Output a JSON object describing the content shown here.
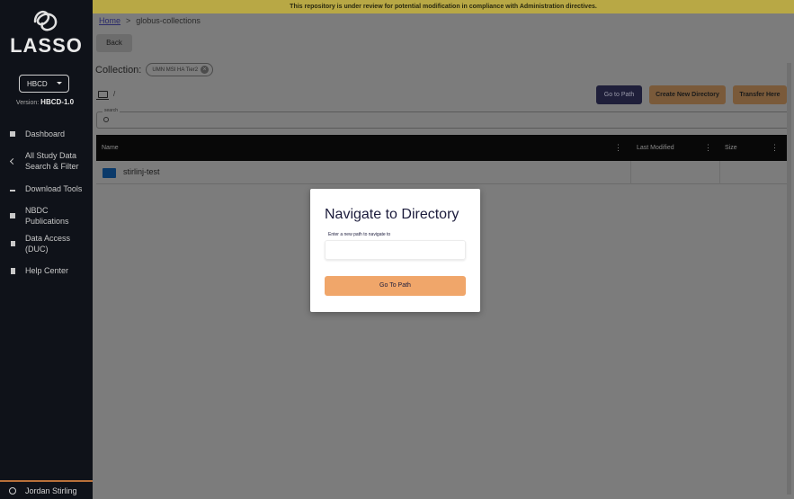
{
  "app": {
    "logo_text": "LASSO"
  },
  "banner": {
    "text": "This repository is under review for potential modification in compliance with Administration directives."
  },
  "sidebar": {
    "study_select": {
      "value": "HBCD"
    },
    "version_label": "Version:",
    "version_value": "HBCD-1.0",
    "items": [
      {
        "label": "Dashboard",
        "icon": "grid-icon"
      },
      {
        "label": "All Study Data Search & Filter",
        "icon": "chart-icon"
      },
      {
        "label": "Download Tools",
        "icon": "download-icon"
      },
      {
        "label": "NBDC Publications",
        "icon": "publication-icon"
      },
      {
        "label": "Data Access (DUC)",
        "icon": "lock-icon"
      },
      {
        "label": "Help Center",
        "icon": "book-icon"
      }
    ],
    "user_name": "Jordan Stirling"
  },
  "breadcrumb": {
    "home": "Home",
    "separator": ">",
    "current": "globus-collections"
  },
  "main": {
    "back_label": "Back",
    "collection_label": "Collection:",
    "collection_chip": "UMN MSI HA Tier2",
    "path": "/",
    "go_to_path_label": "Go to Path",
    "create_dir_label": "Create New Directory",
    "transfer_label": "Transfer Here",
    "search_label": "search",
    "table": {
      "columns": [
        "Name",
        "Last Modified",
        "Size"
      ],
      "rows": [
        {
          "name": "stirlinj-test",
          "last_modified": "",
          "size": ""
        }
      ]
    }
  },
  "modal": {
    "title": "Navigate to Directory",
    "input_label": "Enter a new path to navigate to",
    "input_value": "",
    "submit_label": "Go To Path"
  },
  "colors": {
    "sidebar_bg": "#0f1219",
    "banner_bg": "#f0d860",
    "accent_orange": "#f0a66a",
    "accent_navy": "#1c1c3c",
    "folder_blue": "#1565c0"
  }
}
